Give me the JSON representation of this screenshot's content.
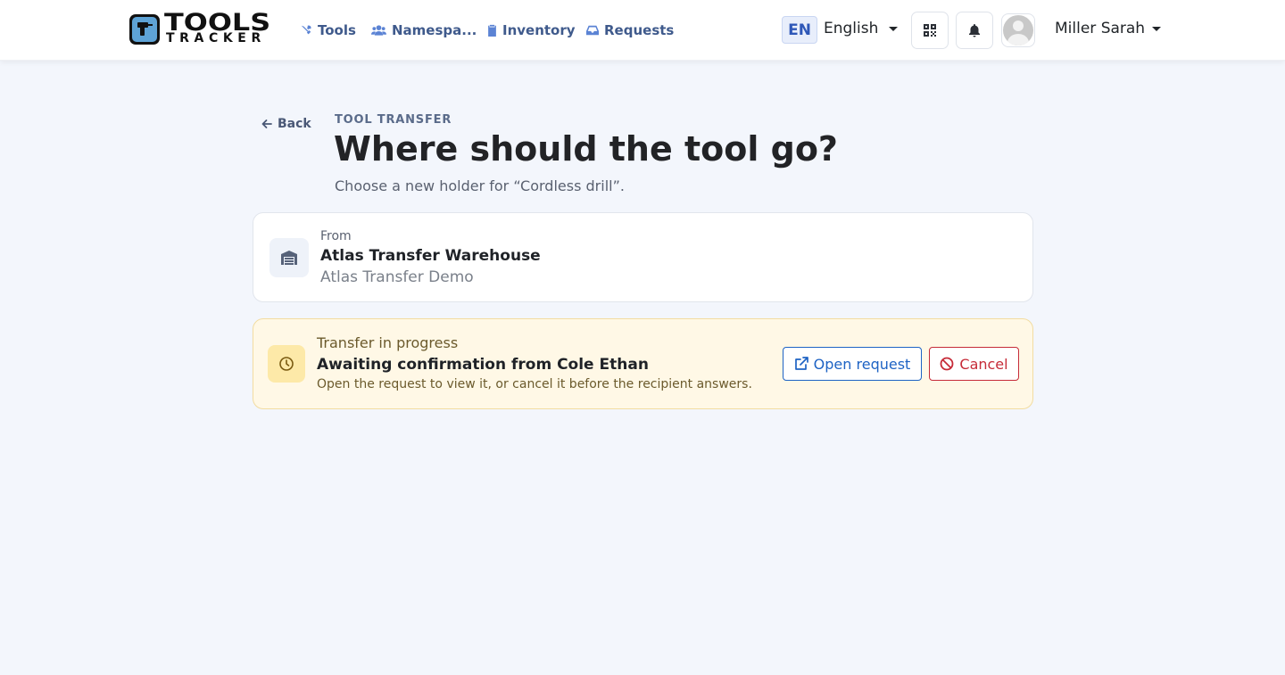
{
  "brand": {
    "line1": "TOOLS",
    "line2": "TRACKER"
  },
  "nav": {
    "tools": "Tools",
    "namespaces": "Namespa...",
    "inventory": "Inventory",
    "requests": "Requests"
  },
  "language": {
    "code": "EN",
    "name": "English"
  },
  "user": {
    "name": "Miller Sarah"
  },
  "header": {
    "back": "Back",
    "eyebrow": "TOOL TRANSFER",
    "title": "Where should the tool go?",
    "subtitle": "Choose a new holder for “Cordless drill”."
  },
  "from": {
    "label": "From",
    "name": "Atlas Transfer Warehouse",
    "sub": "Atlas Transfer Demo"
  },
  "transfer": {
    "label": "Transfer in progress",
    "title": "Awaiting confirmation from Cole Ethan",
    "desc": "Open the request to view it, or cancel it before the recipient answers.",
    "open_label": "Open request",
    "cancel_label": "Cancel"
  },
  "icons": {
    "tools": "tools-icon",
    "namespaces": "users-icon",
    "inventory": "clipboard-icon",
    "requests": "inbox-icon",
    "qr": "qr-code-icon",
    "bell": "bell-icon",
    "warehouse": "warehouse-icon",
    "clock": "clock-icon",
    "open": "external-link-icon",
    "cancel": "ban-icon",
    "back": "arrow-left-icon"
  },
  "colors": {
    "accent": "#1e63c4",
    "danger": "#c62b38",
    "warning_bg": "#fff8e6",
    "page_bg": "#f3f6fc"
  }
}
